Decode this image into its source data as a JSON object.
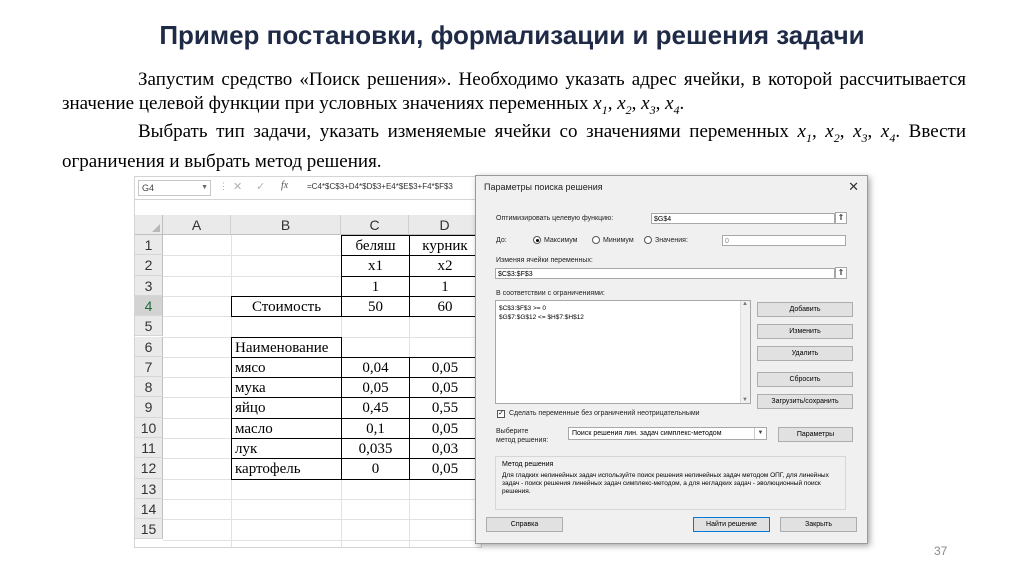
{
  "slide": {
    "title": "Пример постановки, формализации и решения задачи",
    "p1_text": "Запустим средство «Поиск решения». Необходимо указать адрес ячейки, в которой рассчитывается значение целевой функции при условных значениях переменных",
    "p2_text": "Выбрать тип задачи, указать изменяемые ячейки со значениями переменных",
    "p3_text": ". Ввести ограничения и выбрать метод решения.",
    "var_x": "x",
    "sub1": "1",
    "sub2": "2",
    "sub3": "3",
    "sub4": "4",
    "page_number": "37"
  },
  "excel": {
    "name_box": "G4",
    "formula": "=C4*$C$3+D4*$D$3+E4*$E$3+F4*$F$3",
    "columns": [
      "A",
      "B",
      "C",
      "D"
    ],
    "rows": [
      "1",
      "2",
      "3",
      "4",
      "5",
      "6",
      "7",
      "8",
      "9",
      "10",
      "11",
      "12",
      "13",
      "14",
      "15"
    ],
    "header": {
      "c1": "беляш",
      "d1": "курник",
      "c2": "x1",
      "d2": "x2",
      "c3": "1",
      "d3": "1"
    },
    "cost": {
      "label": "Стоимость",
      "c": "50",
      "d": "60"
    },
    "ingredients_header": "Наименование",
    "ingredients": [
      {
        "name": "мясо",
        "c": "0,04",
        "d": "0,05"
      },
      {
        "name": "мука",
        "c": "0,05",
        "d": "0,05"
      },
      {
        "name": "яйцо",
        "c": "0,45",
        "d": "0,55"
      },
      {
        "name": "масло",
        "c": "0,1",
        "d": "0,05"
      },
      {
        "name": "лук",
        "c": "0,035",
        "d": "0,03"
      },
      {
        "name": "картофель",
        "c": "0",
        "d": "0,05"
      }
    ]
  },
  "dialog": {
    "title": "Параметры поиска решения",
    "objective_label": "Оптимизировать целевую функцию:",
    "objective_value": "$G$4",
    "to_label": "До:",
    "radio_max": "Максимум",
    "radio_min": "Минимум",
    "radio_value": "Значения:",
    "value_field": "0",
    "changing_label": "Изменяя ячейки переменных:",
    "changing_value": "$C$3:$F$3",
    "constraints_label": "В соответствии с ограничениями:",
    "constraints": [
      "$C$3:$F$3 >= 0",
      "$G$7:$G$12 <= $H$7:$H$12"
    ],
    "btn_add": "Добавить",
    "btn_change": "Изменить",
    "btn_delete": "Удалить",
    "btn_reset": "Сбросить",
    "btn_load_save": "Загрузить/сохранить",
    "nonneg_label": "Сделать переменные без ограничений неотрицательными",
    "method_label_1": "Выберите",
    "method_label_2": "метод решения:",
    "method_value": "Поиск решения лин. задач симплекс-методом",
    "btn_params": "Параметры",
    "method_group_title": "Метод решения",
    "method_desc": "Для гладких нелинейных задач используйте поиск решения нелинейных задач методом ОПГ, для линейных задач - поиск решения линейных задач симплекс-методом, а для негладких задач - эволюционный поиск решения.",
    "btn_help": "Справка",
    "btn_solve": "Найти решение",
    "btn_close": "Закрыть"
  }
}
